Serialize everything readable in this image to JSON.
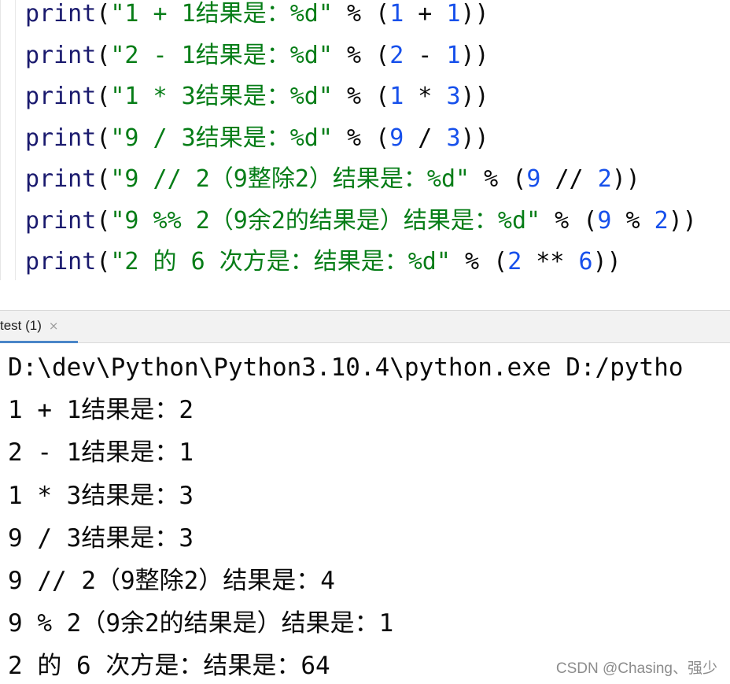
{
  "editor": {
    "lines": [
      [
        {
          "t": "print",
          "c": "fn"
        },
        {
          "t": "(",
          "c": "op"
        },
        {
          "t": "\"1 + 1结果是：%d\"",
          "c": "str"
        },
        {
          "t": " % (",
          "c": "op"
        },
        {
          "t": "1",
          "c": "num"
        },
        {
          "t": " + ",
          "c": "op"
        },
        {
          "t": "1",
          "c": "num"
        },
        {
          "t": "))",
          "c": "op"
        }
      ],
      [
        {
          "t": "print",
          "c": "fn"
        },
        {
          "t": "(",
          "c": "op"
        },
        {
          "t": "\"2 - 1结果是：%d\"",
          "c": "str"
        },
        {
          "t": " % (",
          "c": "op"
        },
        {
          "t": "2",
          "c": "num"
        },
        {
          "t": " - ",
          "c": "op"
        },
        {
          "t": "1",
          "c": "num"
        },
        {
          "t": "))",
          "c": "op"
        }
      ],
      [
        {
          "t": "print",
          "c": "fn"
        },
        {
          "t": "(",
          "c": "op"
        },
        {
          "t": "\"1 * 3结果是：%d\"",
          "c": "str"
        },
        {
          "t": " % (",
          "c": "op"
        },
        {
          "t": "1",
          "c": "num"
        },
        {
          "t": " * ",
          "c": "op"
        },
        {
          "t": "3",
          "c": "num"
        },
        {
          "t": "))",
          "c": "op"
        }
      ],
      [
        {
          "t": "print",
          "c": "fn"
        },
        {
          "t": "(",
          "c": "op"
        },
        {
          "t": "\"9 / 3结果是：%d\"",
          "c": "str"
        },
        {
          "t": " % (",
          "c": "op"
        },
        {
          "t": "9",
          "c": "num"
        },
        {
          "t": " / ",
          "c": "op"
        },
        {
          "t": "3",
          "c": "num"
        },
        {
          "t": "))",
          "c": "op"
        }
      ],
      [
        {
          "t": "print",
          "c": "fn"
        },
        {
          "t": "(",
          "c": "op"
        },
        {
          "t": "\"9 // 2（9整除2）结果是：%d\"",
          "c": "str"
        },
        {
          "t": " % (",
          "c": "op"
        },
        {
          "t": "9",
          "c": "num"
        },
        {
          "t": " // ",
          "c": "op"
        },
        {
          "t": "2",
          "c": "num"
        },
        {
          "t": "))",
          "c": "op"
        }
      ],
      [
        {
          "t": "print",
          "c": "fn"
        },
        {
          "t": "(",
          "c": "op"
        },
        {
          "t": "\"9 %% 2（9余2的结果是）结果是：%d\"",
          "c": "str"
        },
        {
          "t": " % (",
          "c": "op"
        },
        {
          "t": "9",
          "c": "num"
        },
        {
          "t": " % ",
          "c": "op"
        },
        {
          "t": "2",
          "c": "num"
        },
        {
          "t": "))",
          "c": "op"
        }
      ],
      [
        {
          "t": "print",
          "c": "fn"
        },
        {
          "t": "(",
          "c": "op"
        },
        {
          "t": "\"2 的 6 次方是：结果是：%d\"",
          "c": "str"
        },
        {
          "t": " % (",
          "c": "op"
        },
        {
          "t": "2",
          "c": "num"
        },
        {
          "t": " ** ",
          "c": "op"
        },
        {
          "t": "6",
          "c": "num"
        },
        {
          "t": "))",
          "c": "op"
        }
      ]
    ]
  },
  "run_tab": {
    "label": "test (1)",
    "close_glyph": "×"
  },
  "console": {
    "lines": [
      "D:\\dev\\Python\\Python3.10.4\\python.exe D:/pytho",
      "1 + 1结果是：2",
      "2 - 1结果是：1",
      "1 * 3结果是：3",
      "9 / 3结果是：3",
      "9 // 2（9整除2）结果是：4",
      "9 % 2（9余2的结果是）结果是：1",
      "2 的 6 次方是：结果是：64"
    ]
  },
  "watermark": "CSDN @Chasing、强少",
  "colors": {
    "function": "#1a1a6e",
    "string": "#067d17",
    "number": "#1750eb",
    "tab_underline": "#4a86c8"
  }
}
